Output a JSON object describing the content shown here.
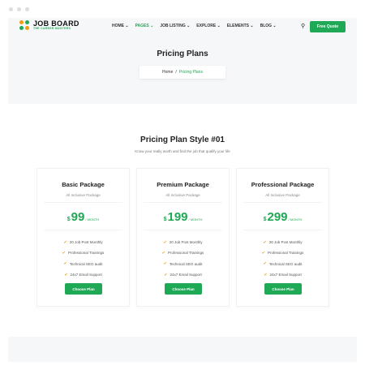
{
  "brand": {
    "title": "JOB BOARD",
    "tagline": "THE CAREER MASTERS"
  },
  "nav": {
    "items": [
      "HOME ⌄",
      "PAGES ⌄",
      "JOB LISTING ⌄",
      "EXPLORE ⌄",
      "ELEMENTS ⌄",
      "BLOG ⌄"
    ],
    "active": 1,
    "cta": "Free Quote"
  },
  "hero": {
    "title": "Pricing Plans",
    "breadcrumb": {
      "home": "Home",
      "sep": "/",
      "current": "Pricing Plans"
    }
  },
  "section": {
    "title": "Pricing Plan Style #01",
    "subtitle": "Know your really worth and find the job that qualify your life"
  },
  "plans": [
    {
      "name": "Basic Package",
      "subtitle": "All Inclusive Package",
      "currency": "$",
      "price": "99",
      "period": "/ MONTH",
      "features": [
        "20 Job Post Monthly",
        "Professional Trainings",
        "Technical SEO audit",
        "24x7 Email Support"
      ],
      "button": "Choose Plan"
    },
    {
      "name": "Premium Package",
      "subtitle": "All Inclusive Package",
      "currency": "$",
      "price": "199",
      "period": "/ MONTH",
      "features": [
        "20 Job Post Monthly",
        "Professional Trainings",
        "Technical SEO audit",
        "24x7 Email Support"
      ],
      "button": "Choose Plan"
    },
    {
      "name": "Professional Package",
      "subtitle": "All Inclusive Package",
      "currency": "$",
      "price": "299",
      "period": "/ MONTH",
      "features": [
        "20 Job Post Monthly",
        "Professional Trainings",
        "Technical SEO audit",
        "24x7 Email Support"
      ],
      "button": "Choose Plan"
    }
  ],
  "colors": {
    "accent": "#1fa855",
    "check": "#f39c12"
  }
}
